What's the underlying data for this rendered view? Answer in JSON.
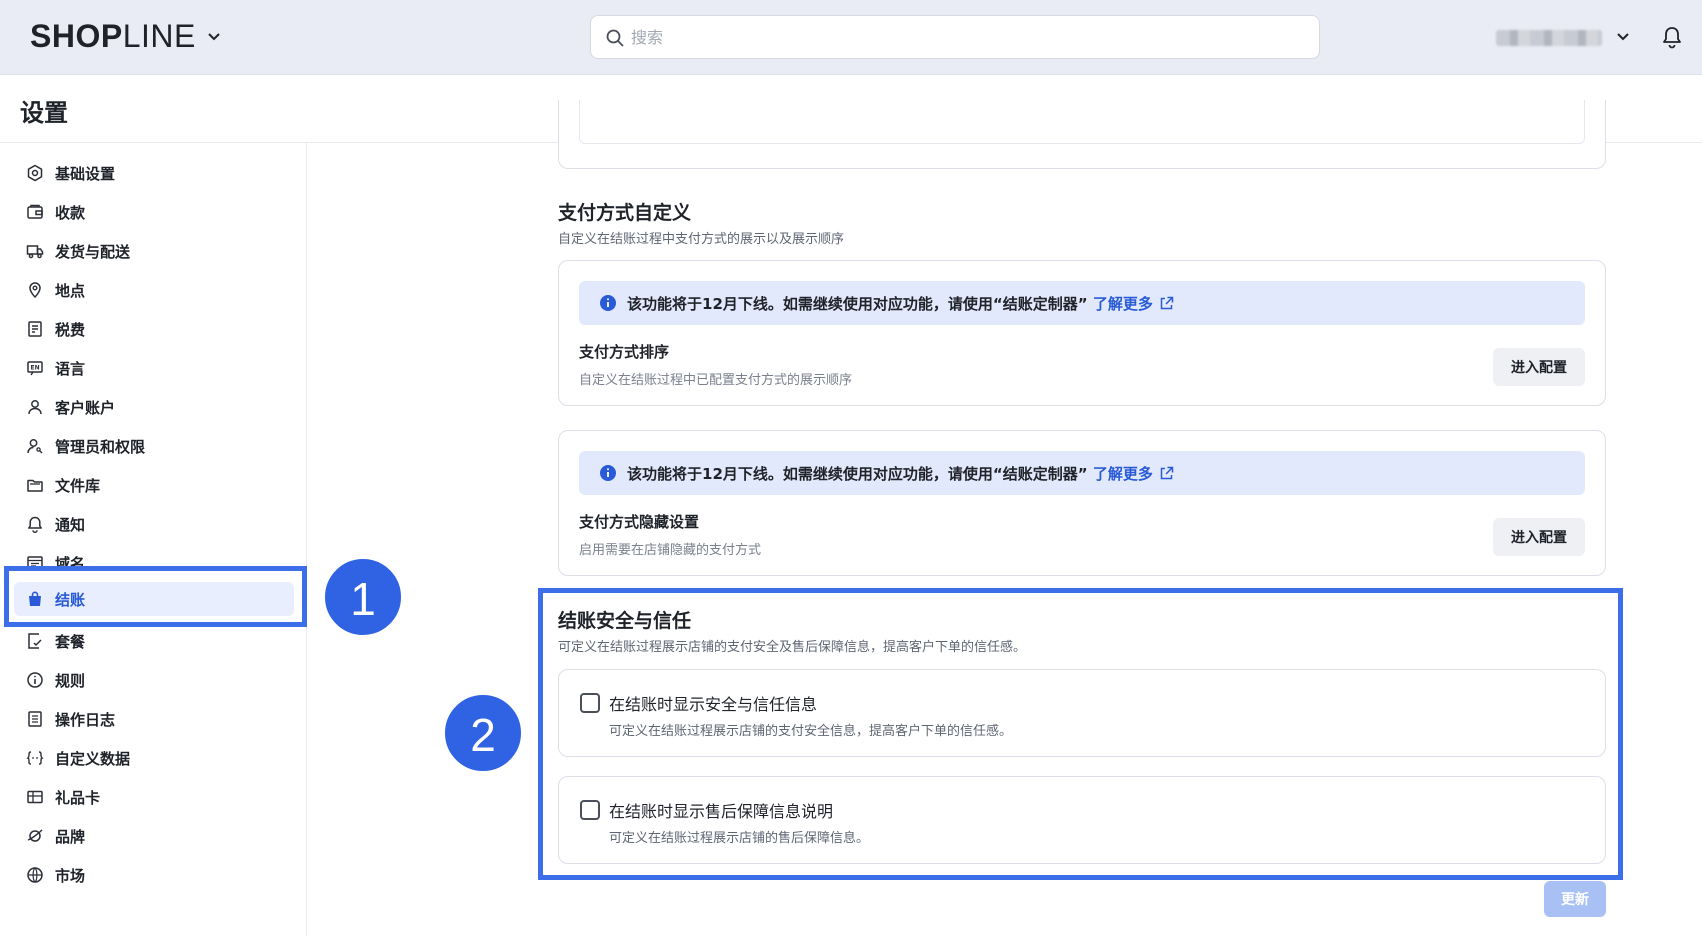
{
  "header": {
    "logo_bold": "SHOP",
    "logo_thin": "LINE",
    "search_placeholder": "搜索"
  },
  "page": {
    "title": "设置"
  },
  "sidebar": {
    "items": [
      {
        "label": "基础设置",
        "icon": "gear-hex-icon"
      },
      {
        "label": "收款",
        "icon": "wallet-icon"
      },
      {
        "label": "发货与配送",
        "icon": "truck-icon"
      },
      {
        "label": "地点",
        "icon": "location-pin-icon"
      },
      {
        "label": "税费",
        "icon": "receipt-icon"
      },
      {
        "label": "语言",
        "icon": "language-icon"
      },
      {
        "label": "客户账户",
        "icon": "user-icon"
      },
      {
        "label": "管理员和权限",
        "icon": "user-key-icon"
      },
      {
        "label": "文件库",
        "icon": "folder-icon"
      },
      {
        "label": "通知",
        "icon": "bell-icon"
      },
      {
        "label": "域名",
        "icon": "browser-icon"
      },
      {
        "label": "结账",
        "icon": "shopping-bag-icon",
        "active": true
      },
      {
        "label": "套餐",
        "icon": "plan-icon"
      },
      {
        "label": "规则",
        "icon": "info-circle-icon"
      },
      {
        "label": "操作日志",
        "icon": "log-icon"
      },
      {
        "label": "自定义数据",
        "icon": "braces-icon"
      },
      {
        "label": "礼品卡",
        "icon": "gift-card-icon"
      },
      {
        "label": "品牌",
        "icon": "brand-icon"
      },
      {
        "label": "市场",
        "icon": "globe-icon"
      }
    ]
  },
  "annotations": {
    "badge1": "1",
    "badge2": "2"
  },
  "payment_custom": {
    "title": "支付方式自定义",
    "desc": "自定义在结账过程中支付方式的展示以及展示顺序",
    "notice_text": "该功能将于12月下线。如需继续使用对应功能，请使用“结账定制器”",
    "notice_link": "了解更多",
    "sort": {
      "title": "支付方式排序",
      "desc": "自定义在结账过程中已配置支付方式的展示顺序",
      "button": "进入配置"
    },
    "hide": {
      "title": "支付方式隐藏设置",
      "desc": "启用需要在店铺隐藏的支付方式",
      "button": "进入配置"
    }
  },
  "trust": {
    "title": "结账安全与信任",
    "desc": "可定义在结账过程展示店铺的支付安全及售后保障信息，提高客户下单的信任感。",
    "options": [
      {
        "label": "在结账时显示安全与信任信息",
        "desc": "可定义在结账过程展示店铺的支付安全信息，提高客户下单的信任感。",
        "checked": false
      },
      {
        "label": "在结账时显示售后保障信息说明",
        "desc": "可定义在结账过程展示店铺的售后保障信息。",
        "checked": false
      }
    ]
  },
  "footer": {
    "update_button": "更新"
  },
  "colors": {
    "accent": "#2a5bd7",
    "highlight": "#3b6ee8",
    "notice_bg": "#e3e9fc"
  }
}
